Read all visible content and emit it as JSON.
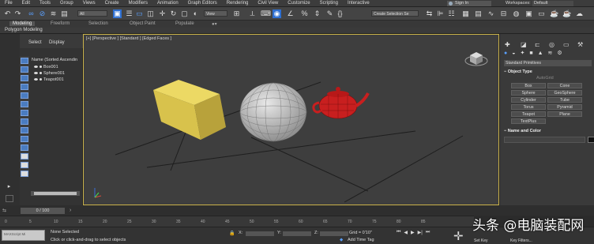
{
  "menu": [
    "File",
    "Edit",
    "Tools",
    "Group",
    "Views",
    "Create",
    "Modifiers",
    "Animation",
    "Graph Editors",
    "Rendering",
    "Civil View",
    "Customize",
    "Scripting",
    "Interactive"
  ],
  "signin": "Sign In",
  "workspaces_label": "Workspaces:",
  "workspace_value": "Default",
  "toolbar": {
    "filter": "All",
    "refcoord": "View",
    "selection_set": "Create Selection Se"
  },
  "ribbon_tabs": [
    "Modeling",
    "Freeform",
    "Selection",
    "Object Paint",
    "Populate"
  ],
  "ribbon_sub": "Polygon Modeling",
  "scene": {
    "tabs": [
      "Select",
      "Display"
    ],
    "header": "Name (Sorted Ascendin",
    "items": [
      "Box001",
      "Sphere001",
      "Teapot001"
    ]
  },
  "viewport": {
    "label": "[+] [Perspective ] [Standard ] [Edged Faces ]"
  },
  "command_panel": {
    "dropdown": "Standard Primitives",
    "object_type_title": "Object Type",
    "autogrid": "AutoGrid",
    "buttons": [
      "Box",
      "Cone",
      "Sphere",
      "GeoSphere",
      "Cylinder",
      "Tube",
      "Torus",
      "Pyramid",
      "Teapot",
      "Plane",
      "TextPlus"
    ],
    "name_color_title": "Name and Color"
  },
  "timeline": {
    "slider": "0 / 100",
    "ticks": [
      "0",
      "5",
      "10",
      "15",
      "20",
      "25",
      "30",
      "35",
      "40",
      "45",
      "50",
      "55",
      "60",
      "65",
      "70",
      "75",
      "80",
      "85"
    ]
  },
  "status": {
    "maxscript": "MAXScript Mi",
    "selected": "None Selected",
    "prompt": "Click or click-and-drag to select objects",
    "x": "X:",
    "y": "Y:",
    "z": "Z:",
    "grid": "Grid = 0'10\"",
    "add_time_tag": "Add Time Tag",
    "set_key": "Set Key",
    "key_filters": "Key Filters..."
  },
  "watermark": "头条 @电脑装配网",
  "colors": {
    "viewport_border": "#c9b24a",
    "box": "#d7c24b",
    "teapot": "#c81f1f",
    "sphere": "#bdbdbd",
    "accent": "#2e6fd1"
  }
}
